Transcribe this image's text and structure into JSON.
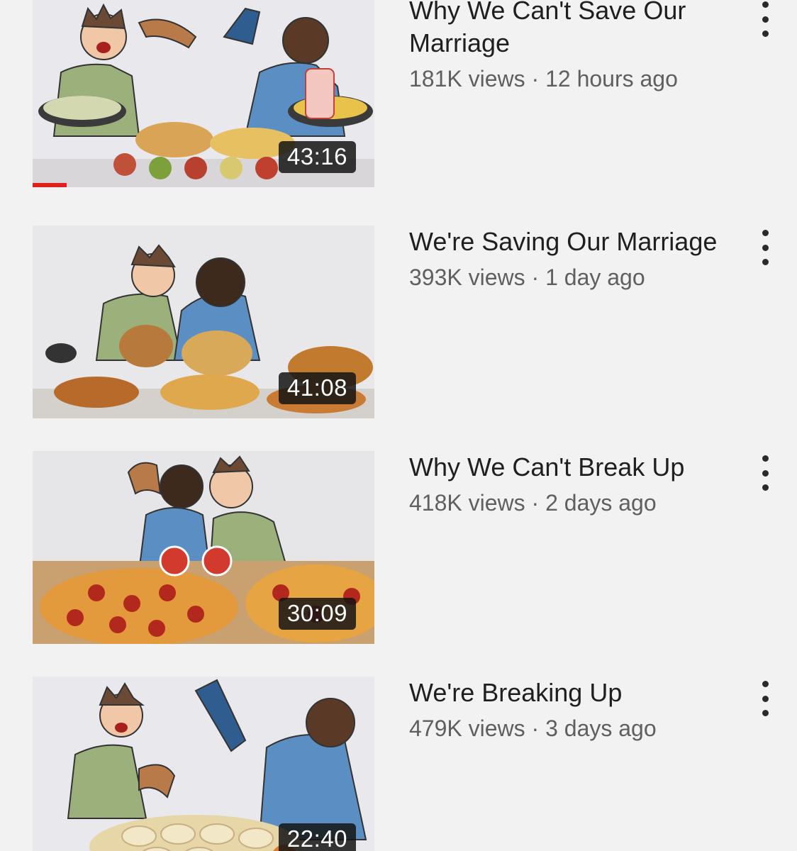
{
  "videos": [
    {
      "title": "Why We Can't Save Our Marriage",
      "views": "181K views",
      "age": "12 hours ago",
      "duration": "43:16",
      "watched_fraction": 0.1,
      "thumbnail": "cartoon-couple-arguing-over-food-spread"
    },
    {
      "title": "We're Saving Our Marriage",
      "views": "393K views",
      "age": "1 day ago",
      "duration": "41:08",
      "thumbnail": "cartoon-couple-embracing-over-fried-food"
    },
    {
      "title": "Why We Can't Break Up",
      "views": "418K views",
      "age": "2 days ago",
      "duration": "30:09",
      "thumbnail": "cartoon-couple-kissing-over-pizza"
    },
    {
      "title": "We're Breaking Up",
      "views": "479K views",
      "age": "3 days ago",
      "duration": "22:40",
      "thumbnail": "cartoon-couple-fighting-over-dumplings"
    }
  ],
  "meta_separator": " · ",
  "icons": {
    "more": "more-vert-icon"
  },
  "colors": {
    "progress": "#e0211b",
    "duration_bg": "#141414",
    "title": "#1f1f1f",
    "meta": "#5f5f5f"
  }
}
